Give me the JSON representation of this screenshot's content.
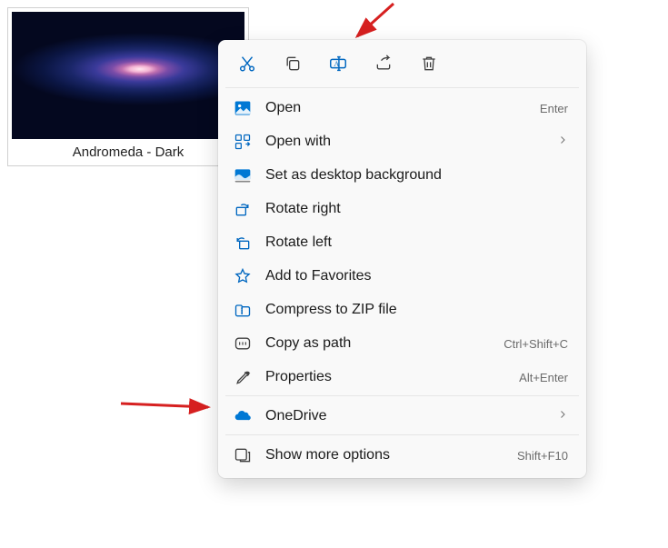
{
  "file": {
    "name": "Andromeda - Dark"
  },
  "toolbar": {
    "cut": "Cut",
    "copy": "Copy",
    "rename": "Rename",
    "share": "Share",
    "delete": "Delete"
  },
  "menu": {
    "open": {
      "label": "Open",
      "shortcut": "Enter"
    },
    "openWith": {
      "label": "Open with"
    },
    "setBg": {
      "label": "Set as desktop background"
    },
    "rotateRight": {
      "label": "Rotate right"
    },
    "rotateLeft": {
      "label": "Rotate left"
    },
    "favorites": {
      "label": "Add to Favorites"
    },
    "zip": {
      "label": "Compress to ZIP file"
    },
    "copyPath": {
      "label": "Copy as path",
      "shortcut": "Ctrl+Shift+C"
    },
    "properties": {
      "label": "Properties",
      "shortcut": "Alt+Enter"
    },
    "onedrive": {
      "label": "OneDrive"
    },
    "more": {
      "label": "Show more options",
      "shortcut": "Shift+F10"
    }
  }
}
